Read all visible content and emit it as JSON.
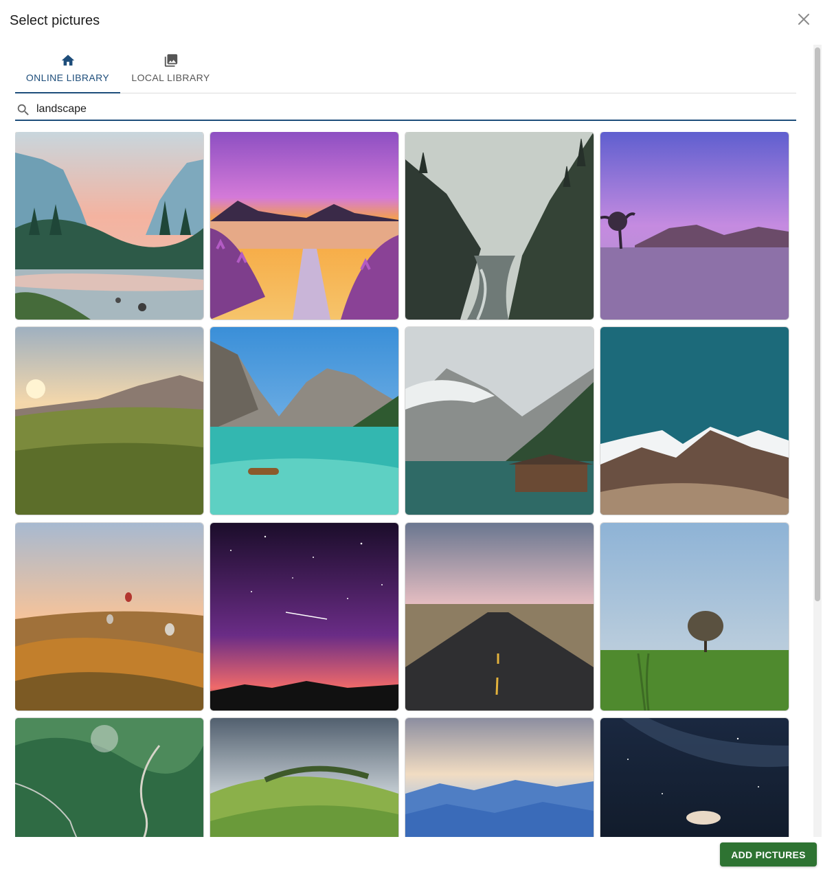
{
  "dialog": {
    "title": "Select pictures"
  },
  "tabs": [
    {
      "label": "ONLINE LIBRARY",
      "icon": "home-icon",
      "active": true
    },
    {
      "label": "LOCAL LIBRARY",
      "icon": "photo-library-icon",
      "active": false
    }
  ],
  "search": {
    "value": "landscape",
    "icon": "search-icon"
  },
  "results": [
    {
      "subject": "valley-river-sunset"
    },
    {
      "subject": "purple-flowers-lake-sunset"
    },
    {
      "subject": "misty-forest-river"
    },
    {
      "subject": "purple-lake-lone-tree"
    },
    {
      "subject": "grassland-sunrise"
    },
    {
      "subject": "turquoise-lake-boat"
    },
    {
      "subject": "mountain-lake-boathouse"
    },
    {
      "subject": "snowy-mountains-teal-sky"
    },
    {
      "subject": "hot-air-balloons-valley"
    },
    {
      "subject": "starry-purple-sky"
    },
    {
      "subject": "open-road-dusk"
    },
    {
      "subject": "lone-tree-green-field"
    },
    {
      "subject": "green-mountain-road"
    },
    {
      "subject": "rolling-green-hills"
    },
    {
      "subject": "blue-mountain-layers"
    },
    {
      "subject": "milky-way-night"
    }
  ],
  "actions": {
    "add_label": "ADD PICTURES"
  },
  "colors": {
    "primary": "#1d4d7a",
    "add_button": "#2e7332"
  }
}
